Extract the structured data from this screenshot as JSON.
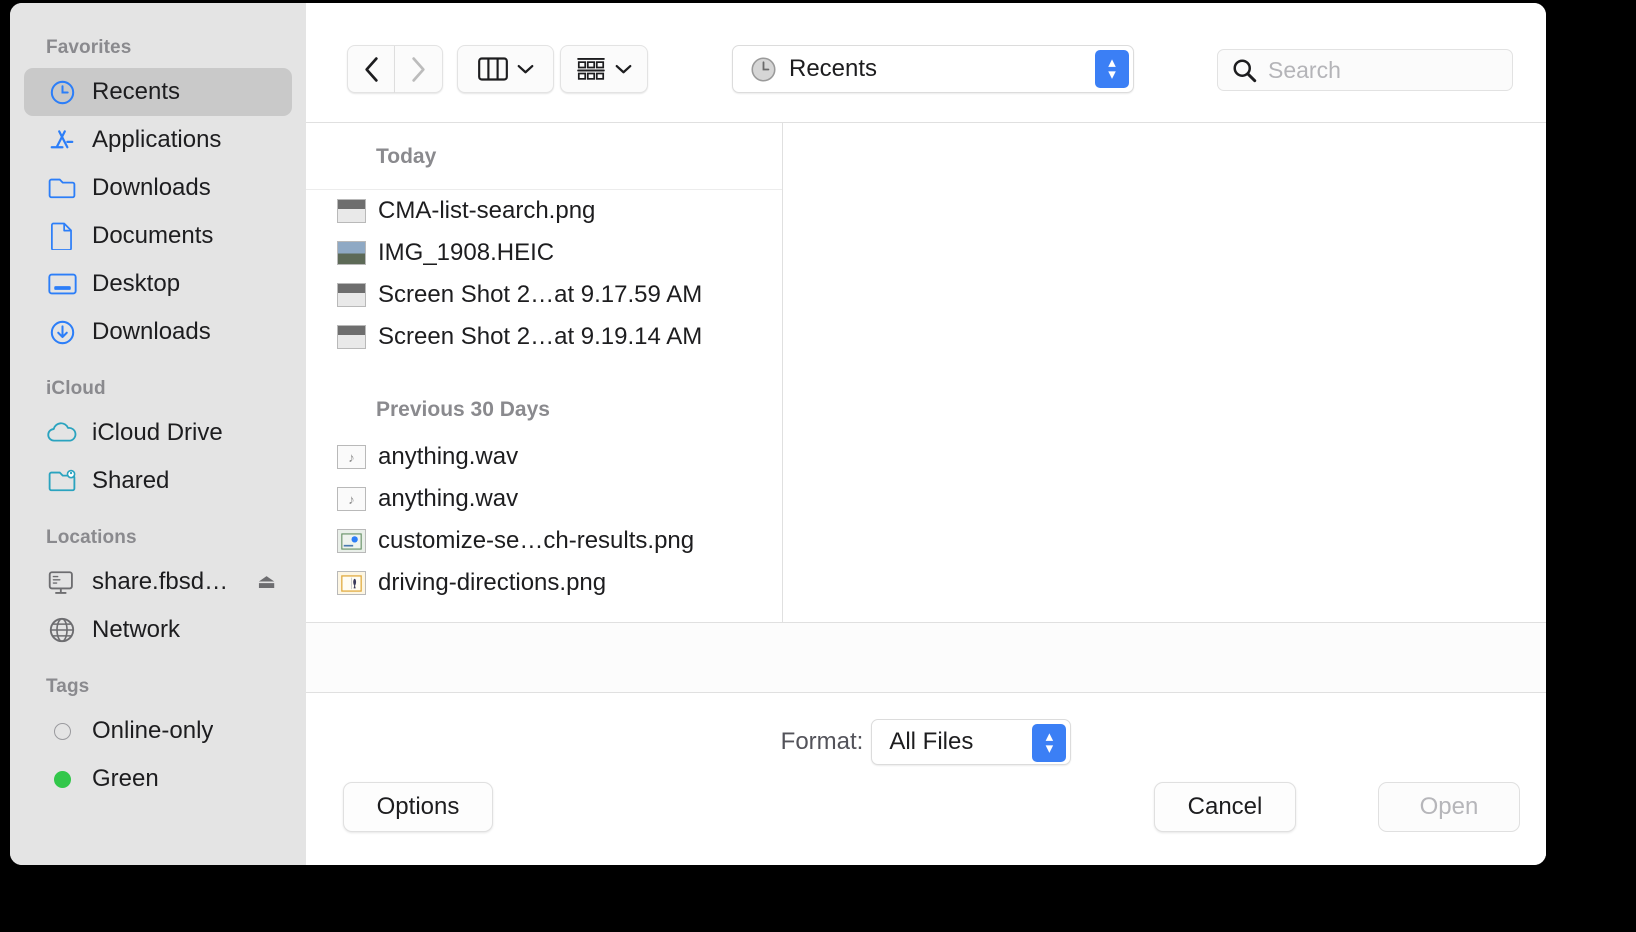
{
  "sidebar": {
    "groups": [
      {
        "title": "Favorites",
        "items": [
          {
            "label": "Recents",
            "icon": "clock-icon",
            "selected": true
          },
          {
            "label": "Applications",
            "icon": "applications-icon",
            "selected": false
          },
          {
            "label": "Downloads",
            "icon": "folder-icon",
            "selected": false
          },
          {
            "label": "Documents",
            "icon": "document-icon",
            "selected": false
          },
          {
            "label": "Desktop",
            "icon": "desktop-icon",
            "selected": false
          },
          {
            "label": "Downloads",
            "icon": "download-icon",
            "selected": false
          }
        ]
      },
      {
        "title": "iCloud",
        "items": [
          {
            "label": "iCloud Drive",
            "icon": "cloud-icon",
            "selected": false
          },
          {
            "label": "Shared",
            "icon": "shared-folder-icon",
            "selected": false
          }
        ]
      },
      {
        "title": "Locations",
        "items": [
          {
            "label": "share.fbsd…",
            "icon": "server-icon",
            "selected": false,
            "eject": "⏏"
          },
          {
            "label": "Network",
            "icon": "network-icon",
            "selected": false
          }
        ]
      },
      {
        "title": "Tags",
        "items": [
          {
            "label": "Online-only",
            "icon": "tag-dot-icon",
            "selected": false
          },
          {
            "label": "Green",
            "icon": "tag-dot-green-icon",
            "selected": false
          }
        ]
      }
    ]
  },
  "toolbar": {
    "back_icon": "chevron-left-icon",
    "forward_icon": "chevron-right-icon",
    "view_icon": "column-view-icon",
    "view_chevron": "chevron-down-icon",
    "group_icon": "group-by-icon",
    "group_chevron": "chevron-down-icon",
    "path_label": "Recents",
    "path_icon": "clock-icon",
    "stepper_up": "▴",
    "stepper_down": "▾",
    "search_icon": "search-icon",
    "search_placeholder": "Search",
    "search_value": ""
  },
  "browser": {
    "sections": [
      {
        "title": "Today",
        "files": [
          {
            "name": "CMA-list-search.png",
            "icon": "screenshot-thumbnail",
            "kind": "shot"
          },
          {
            "name": "IMG_1908.HEIC",
            "icon": "photo-thumbnail",
            "kind": "photo"
          },
          {
            "name": "Screen Shot 2…at 9.17.59 AM",
            "icon": "screenshot-thumbnail",
            "kind": "shot"
          },
          {
            "name": "Screen Shot 2…at 9.19.14 AM",
            "icon": "screenshot-thumbnail",
            "kind": "shot"
          }
        ]
      },
      {
        "title": "Previous 30 Days",
        "files": [
          {
            "name": "anything.wav",
            "icon": "audio-file-icon",
            "kind": "audio",
            "glyph": "♪"
          },
          {
            "name": "anything.wav",
            "icon": "audio-file-icon",
            "kind": "audio",
            "glyph": "♪"
          },
          {
            "name": "customize-se…ch-results.png",
            "icon": "image-thumbnail",
            "kind": "chart"
          },
          {
            "name": "driving-directions.png",
            "icon": "image-thumbnail",
            "kind": "map"
          }
        ]
      }
    ]
  },
  "bottom": {
    "format_label": "Format:",
    "format_value": "All Files",
    "options_label": "Options",
    "cancel_label": "Cancel",
    "open_label": "Open"
  },
  "colors": {
    "accent": "#3b7ff5",
    "sidebar_bg": "#e4e4e4",
    "selected_bg": "#c9c9c9",
    "icon_blue": "#2c7ef8",
    "icon_teal": "#2aa3bf",
    "tag_green": "#32c74a"
  }
}
